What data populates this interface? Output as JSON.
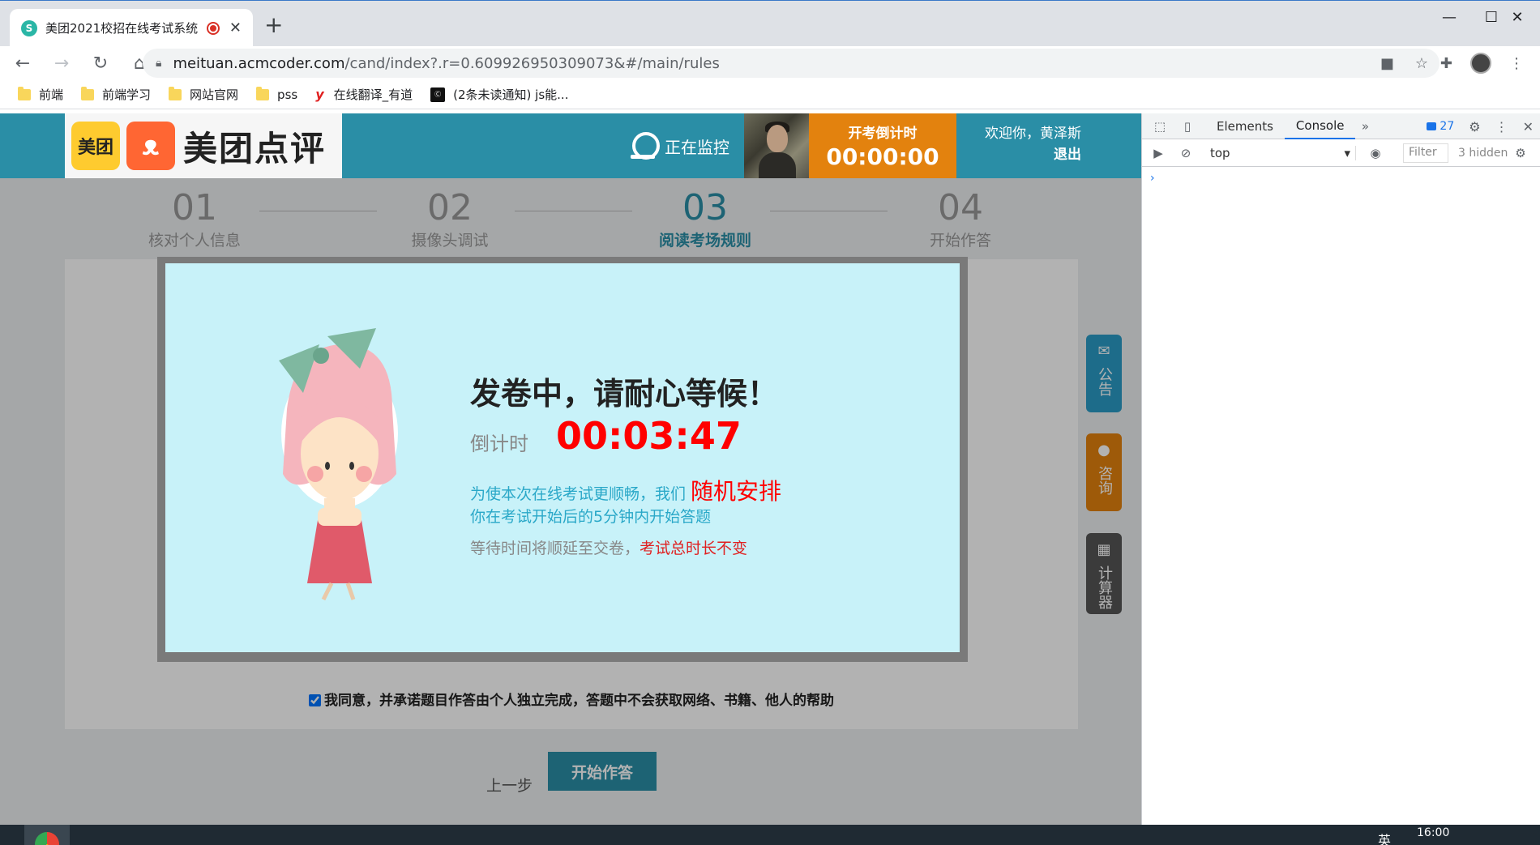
{
  "browser": {
    "tab_title": "美团2021校招在线考试系统",
    "tab_favicon_letter": "S",
    "url_host": "meituan.acmcoder.com",
    "url_path": "/cand/index?.r=0.609926950309073&#/main/rules",
    "bookmarks": [
      {
        "label": "前端",
        "icon": "folder-icon"
      },
      {
        "label": "前端学习",
        "icon": "folder-icon"
      },
      {
        "label": "网站官网",
        "icon": "folder-icon"
      },
      {
        "label": "pss",
        "icon": "folder-icon"
      },
      {
        "label": "在线翻译_有道",
        "icon": "youdao-icon"
      },
      {
        "label": "(2条未读通知) js能...",
        "icon": "site-icon"
      }
    ]
  },
  "header": {
    "logo_meituan": "美团",
    "logo_brand": "美团点评",
    "monitor_label": "正在监控",
    "countdown_label": "开考倒计时",
    "countdown_value": "00:00:00",
    "welcome": "欢迎你，黄泽斯",
    "logout": "退出"
  },
  "steps": [
    {
      "num": "01",
      "label": "核对个人信息"
    },
    {
      "num": "02",
      "label": "摄像头调试"
    },
    {
      "num": "03",
      "label": "阅读考场规则"
    },
    {
      "num": "04",
      "label": "开始作答"
    }
  ],
  "modal": {
    "title": "发卷中，请耐心等候！",
    "countdown_label": "倒计时",
    "countdown_value": "00:03:47",
    "line1": "为使本次在线考试更顺畅，我们",
    "line1_highlight": "随机安排",
    "line2": "你在考试开始后的5分钟内开始答题",
    "line3": "等待时间将顺延至交卷，",
    "line3_highlight": "考试总时长不变"
  },
  "agreement": "我同意，并承诺题目作答由个人独立完成，答题中不会获取网络、书籍、他人的帮助",
  "buttons": {
    "prev": "上一步",
    "start": "开始作答"
  },
  "side_tabs": [
    {
      "label": "公告",
      "icon": "mail-icon",
      "color": "#2a9bc6"
    },
    {
      "label": "咨询",
      "icon": "chat-icon",
      "color": "#e3820e"
    },
    {
      "label": "计算器",
      "icon": "calculator-icon",
      "color": "#555555"
    }
  ],
  "devtools": {
    "tabs": [
      "Elements",
      "Console"
    ],
    "issues_count": "27",
    "context": "top",
    "filter_placeholder": "Filter",
    "hidden": "3 hidden",
    "prompt": "›"
  },
  "taskbar": {
    "time": "16:00",
    "lang": "英"
  }
}
